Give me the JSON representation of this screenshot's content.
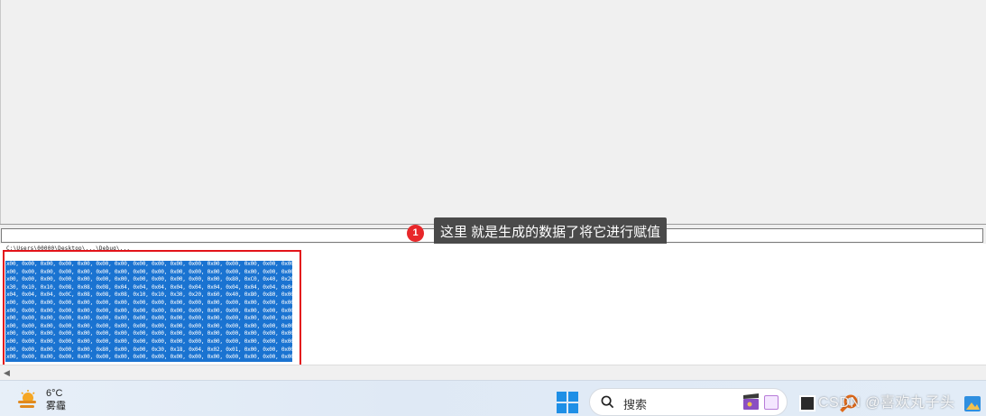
{
  "callout": {
    "number": "1",
    "text": "这里 就是生成的数据了将它进行赋值"
  },
  "output": {
    "path": "C:\\Users\\00000\\Desktop\\...\\Debug\\...",
    "data_rows": [
      "x00, 0x00, 0x00, 0x00, 0x00, 0x00, 0x00, 0x00, 0x00, 0x00, 0x00, 0x00, 0x00, 0x00, 0x00, 0x00,",
      "x00, 0x00, 0x00, 0x00, 0x00, 0x00, 0x00, 0x00, 0x00, 0x00, 0x00, 0x00, 0x00, 0x00, 0x00, 0x00,",
      "x00, 0x00, 0x00, 0x00, 0x00, 0x00, 0x00, 0x00, 0x00, 0x00, 0x00, 0x00, 0x80, 0xC0, 0x40, 0x20,",
      "x30, 0x10, 0x10, 0x08, 0x08, 0x08, 0x04, 0x04, 0x04, 0x04, 0x04, 0x04, 0x04, 0x04, 0x04, 0x04,",
      "x04, 0x04, 0x04, 0x0C, 0x08, 0x08, 0x08, 0x10, 0x10, 0x30, 0x20, 0x60, 0x40, 0x80, 0x80, 0x00,",
      "x00, 0x00, 0x00, 0x00, 0x00, 0x00, 0x00, 0x00, 0x00, 0x00, 0x00, 0x00, 0x00, 0x00, 0x00, 0x00,",
      "x00, 0x00, 0x00, 0x00, 0x00, 0x00, 0x00, 0x00, 0x00, 0x00, 0x00, 0x00, 0x00, 0x00, 0x00, 0x00,",
      "x00, 0x00, 0x00, 0x00, 0x00, 0x00, 0x00, 0x00, 0x00, 0x00, 0x00, 0x00, 0x00, 0x00, 0x00, 0x00,",
      "x00, 0x00, 0x00, 0x00, 0x00, 0x00, 0x00, 0x00, 0x00, 0x00, 0x00, 0x00, 0x00, 0x00, 0x00, 0x00,",
      "x00, 0x00, 0x00, 0x00, 0x00, 0x00, 0x00, 0x00, 0x00, 0x00, 0x00, 0x00, 0x00, 0x00, 0x00, 0x00,",
      "x00, 0x00, 0x00, 0x00, 0x00, 0x00, 0x00, 0x00, 0x00, 0x00, 0x00, 0x00, 0x00, 0x00, 0x00, 0x00,",
      "x00, 0x00, 0x00, 0x00, 0x00, 0x80, 0x00, 0x00, 0x30, 0x18, 0x04, 0x02, 0x01, 0x00, 0x00, 0x00,",
      "x00, 0x00, 0x00, 0x00, 0x00, 0x00, 0x00, 0x00, 0x00, 0x00, 0x00, 0x00, 0x00, 0x00, 0x00, 0x00,",
      "x00, 0x00, 0x00, 0x00, 0x00, 0x00, 0x00, 0x00, 0x00, 0x00, 0x00, 0x00, 0x00, 0x00, 0x01, 0x03,",
      "x06, 0x0C, 0x18, 0x60, 0xC0, 0x00, 0x00, 0x00, 0x00, 0x00, 0x00, 0x00, 0x00, 0x00, 0x00, 0x00,"
    ]
  },
  "taskbar": {
    "weather_temp": "6°C",
    "weather_condition": "雾霾",
    "search_label": "搜索"
  },
  "watermark": "CSDN @喜欢丸子头",
  "colors": {
    "highlight_border": "#e3141a",
    "selection": "#1a73d1",
    "callout_badge": "#e8272a",
    "callout_bg": "#4a4a4a"
  },
  "icons": {
    "start": "windows-start-icon",
    "search": "search-icon",
    "weather": "weather-sun-cloud-icon"
  }
}
